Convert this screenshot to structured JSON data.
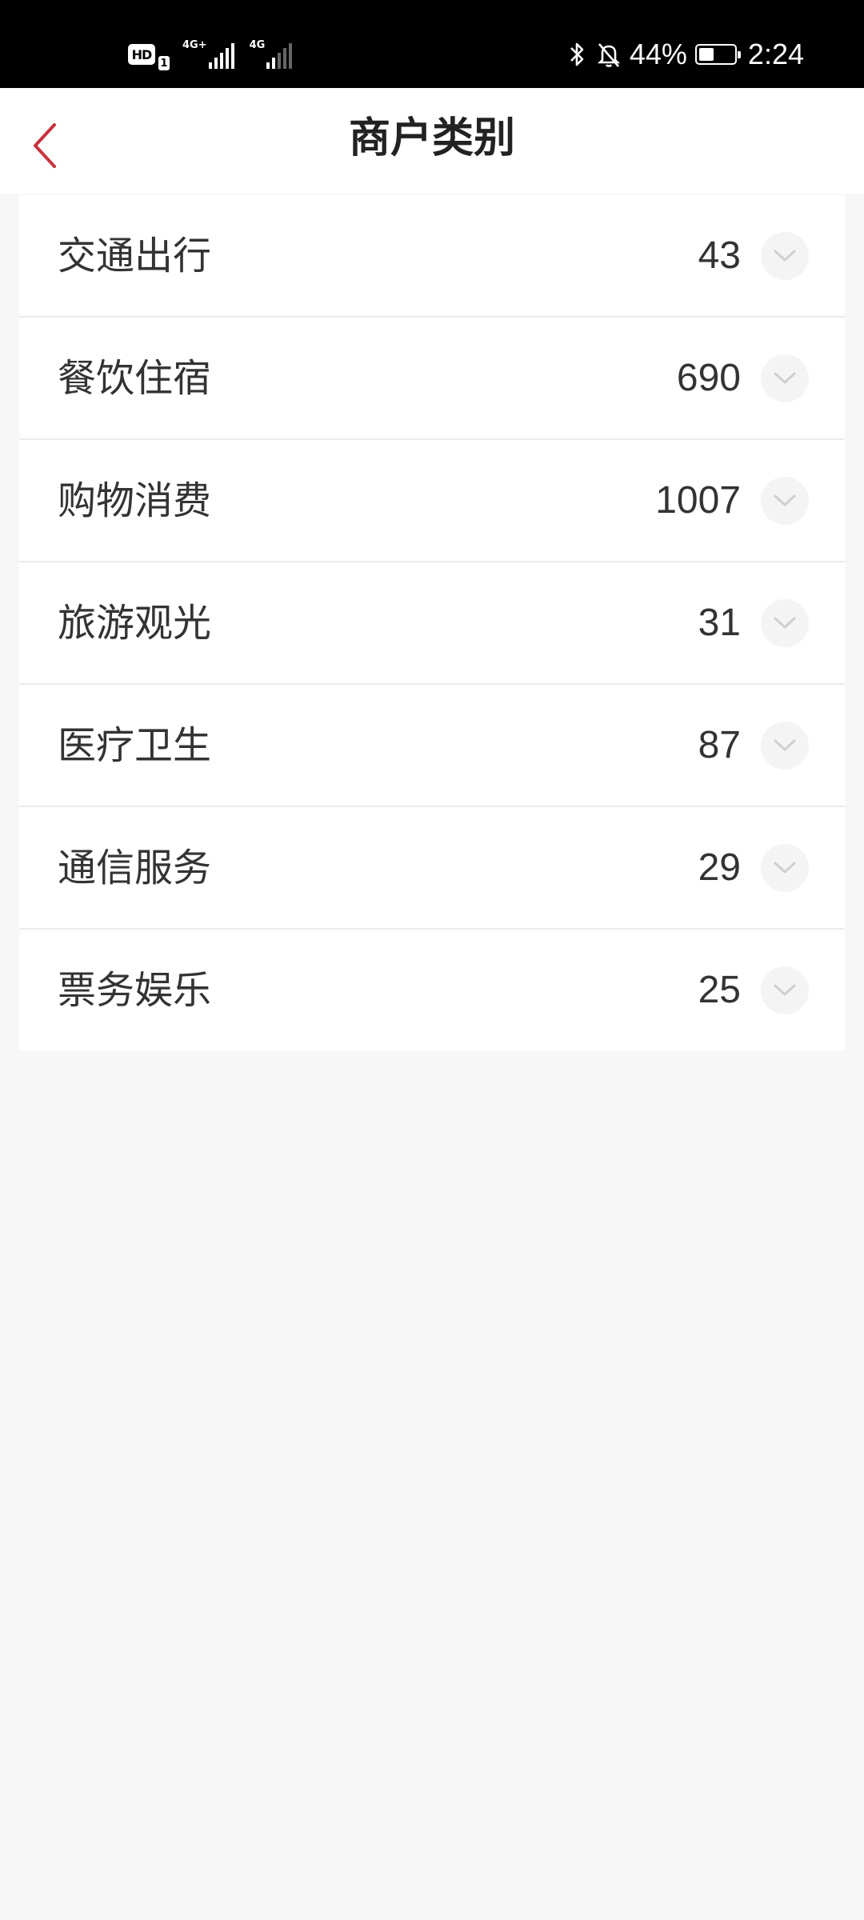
{
  "status_bar": {
    "hd_label": "HD",
    "sim_label": "1",
    "sim1_network": "4G+",
    "sim2_network": "4G",
    "battery_percent": "44%",
    "battery_level": 0.44,
    "time": "2:24"
  },
  "header": {
    "title": "商户类别",
    "accent_color": "#c8323c"
  },
  "categories": [
    {
      "name": "交通出行",
      "count": "43"
    },
    {
      "name": "餐饮住宿",
      "count": "690"
    },
    {
      "name": "购物消费",
      "count": "1007"
    },
    {
      "name": "旅游观光",
      "count": "31"
    },
    {
      "name": "医疗卫生",
      "count": "87"
    },
    {
      "name": "通信服务",
      "count": "29"
    },
    {
      "name": "票务娱乐",
      "count": "25"
    }
  ]
}
